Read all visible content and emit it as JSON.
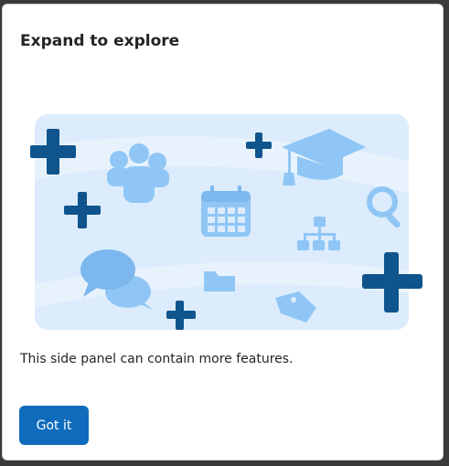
{
  "dialog": {
    "title": "Expand to explore",
    "description": "This side panel can contain more features.",
    "primary_button": "Got it"
  },
  "illustration": {
    "icons": [
      "plus-icon",
      "people-icon",
      "calendar-icon",
      "graduation-cap-icon",
      "search-icon",
      "org-chart-icon",
      "chat-bubbles-icon",
      "folder-icon",
      "tag-icon"
    ]
  },
  "colors": {
    "accent": "#0f6cbd",
    "plus_dark": "#0f548c",
    "icon_light": "#8fc6f5",
    "card_bg": "#dcecfc"
  }
}
